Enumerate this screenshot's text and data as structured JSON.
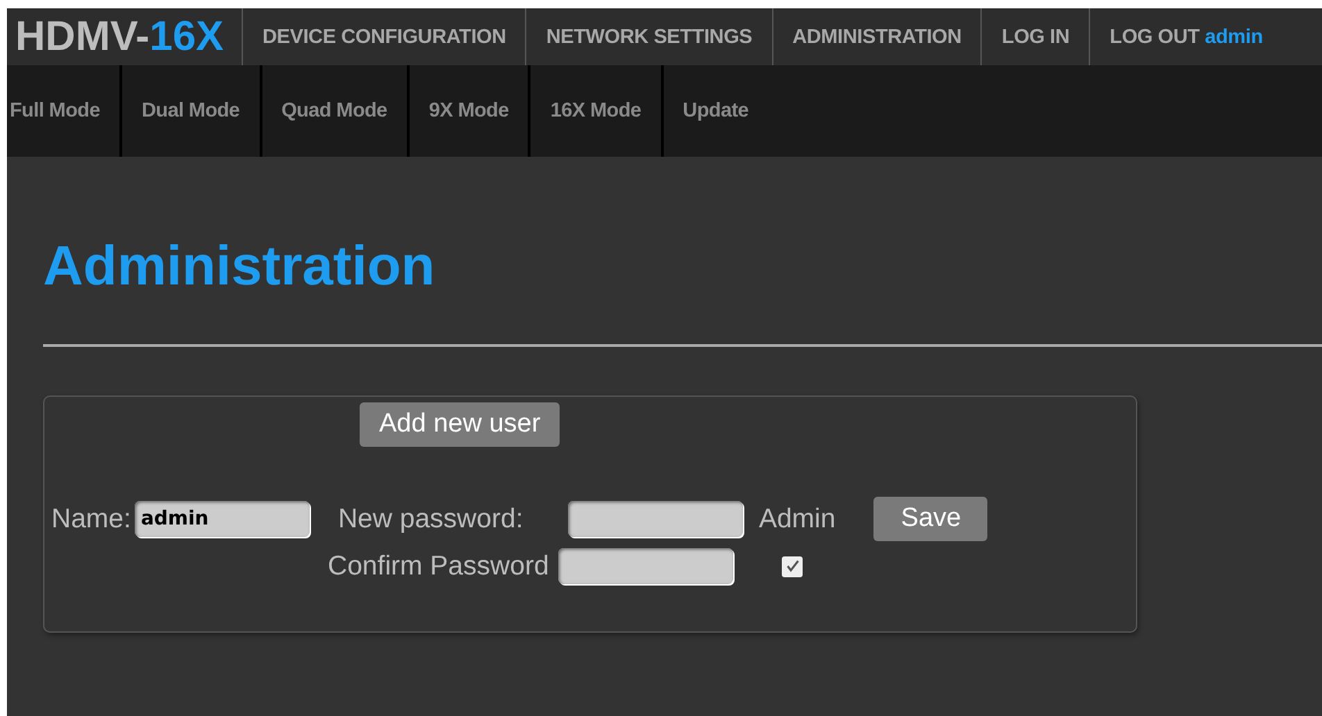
{
  "logo": {
    "text": "HDMV-",
    "accent": "16X"
  },
  "nav": [
    {
      "label": "DEVICE CONFIGURATION"
    },
    {
      "label": "NETWORK SETTINGS"
    },
    {
      "label": "ADMINISTRATION"
    },
    {
      "label": "LOG IN"
    },
    {
      "label": "LOG OUT",
      "user": "admin"
    }
  ],
  "subnav": [
    "Full Mode",
    "Dual Mode",
    "Quad Mode",
    "9X Mode",
    "16X Mode",
    "Update"
  ],
  "heading": "Administration",
  "form": {
    "add_button": "Add new user",
    "name_label": "Name:",
    "name_value": "admin",
    "new_password_label": "New password:",
    "role": "Admin",
    "save_button": "Save",
    "confirm_label": "Confirm Password",
    "role_checked": true
  }
}
